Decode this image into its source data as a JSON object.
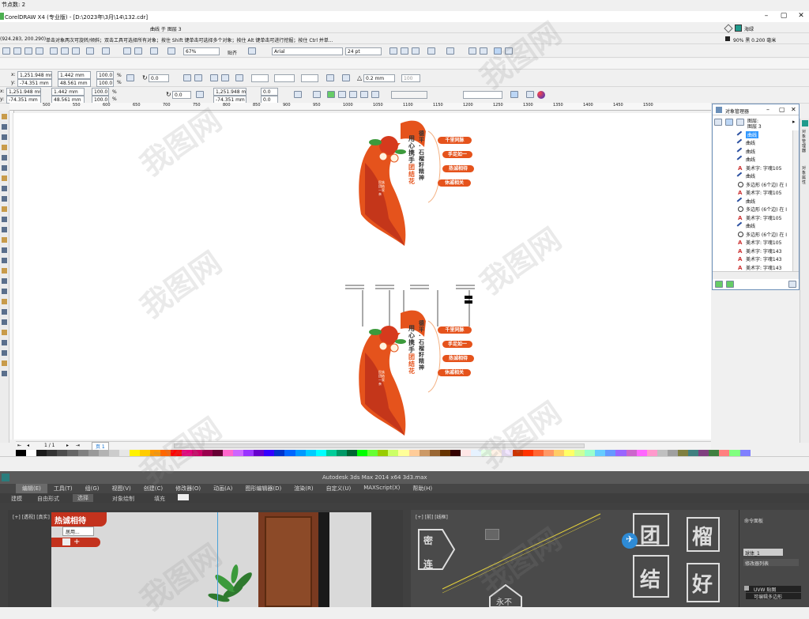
{
  "cdr": {
    "top_left_text": "节点数: 2",
    "window_title": "CorelDRAW X4 (专业版) - [D:\\2023年\\3月\\14\\132.cdr]",
    "window_controls": [
      "–",
      "▢",
      "✕"
    ],
    "selection_status": "曲线 于 图层 3",
    "coords": "(924.283, 200.290)",
    "hint": "单击对象两次可旋转/倾斜；双击工具可选择所有对象；按住 Shift 键单击可选择多个对象；按住 Alt 键单击可进行挖掘；按住 Ctrl 并单...",
    "fill_name": "海绿",
    "outline_info": "90% 黑 0.200 毫米",
    "zoom": "67%",
    "snap_label": "贴齐",
    "font_name": "Arial",
    "font_size": "24 pt",
    "prop1": {
      "x": "1,251.948 mm",
      "y": "-74.351 mm",
      "w": "1.442 mm",
      "h": "48.561 mm",
      "sx": "100.0",
      "sy": "100.0",
      "pct": "%",
      "angle": "0.0",
      "outline_w": "0.2 mm",
      "mirror_pct": "100"
    },
    "prop2": {
      "x": "1,251.948 mm",
      "y": "-74.351 mm",
      "w": "1.442 mm",
      "h": "48.561 mm",
      "sx": "100.0",
      "sy": "100.0",
      "pct": "%",
      "angle": "0.0",
      "px": "1,251.948 mm",
      "py": "-74.351 mm",
      "ox": "0.0",
      "oy": "0.0"
    },
    "ruler_ticks": [
      "500",
      "550",
      "600",
      "650",
      "700",
      "750",
      "800",
      "850",
      "900",
      "950",
      "1000",
      "1050",
      "1100",
      "1150",
      "1200",
      "1250",
      "1300",
      "1350",
      "1400",
      "1450",
      "1500"
    ],
    "page_nav": {
      "count": "1 / 1",
      "page_tab": "页 1"
    }
  },
  "design": {
    "upper": {
      "vertical_left": "用心携手",
      "vertical_left_hl": "团结花",
      "vertical_right": "德平·石榴籽精神",
      "tags": [
        "千里同脉",
        "手足如一",
        "热诚相待",
        "休戚相关"
      ],
      "red_side_text": "民族团结一家亲"
    },
    "lower": {
      "vertical_left": "用心携手",
      "vertical_left_hl": "团结花",
      "vertical_right": "德平·石榴籽精神",
      "tags": [
        "千里同脉",
        "手足如一",
        "热诚相待",
        "休戚相关"
      ],
      "red_side_text": "民族团结一家亲"
    }
  },
  "objmgr": {
    "title": "对象管理器",
    "layer_line1": "图层:",
    "layer_line2": "图层 3",
    "items": [
      {
        "label": "曲线",
        "icon": "curve-icon",
        "selected": true
      },
      {
        "label": "曲线",
        "icon": "curve-icon",
        "selected": false
      },
      {
        "label": "曲线",
        "icon": "curve-icon",
        "selected": false
      },
      {
        "label": "曲线",
        "icon": "curve-icon",
        "selected": false
      },
      {
        "label": "美术字: 字魂105",
        "icon": "artistic-text-icon",
        "selected": false
      },
      {
        "label": "曲线",
        "icon": "curve-icon",
        "selected": false
      },
      {
        "label": "多边形 (6个边) 在 I",
        "icon": "polygon-icon",
        "selected": false
      },
      {
        "label": "美术字: 字魂105",
        "icon": "artistic-text-icon",
        "selected": false
      },
      {
        "label": "曲线",
        "icon": "curve-icon",
        "selected": false
      },
      {
        "label": "多边形 (6个边) 在 I",
        "icon": "polygon-icon",
        "selected": false
      },
      {
        "label": "美术字: 字魂105",
        "icon": "artistic-text-icon",
        "selected": false
      },
      {
        "label": "曲线",
        "icon": "curve-icon",
        "selected": false
      },
      {
        "label": "多边形 (6个边) 在 I",
        "icon": "polygon-icon",
        "selected": false
      },
      {
        "label": "美术字: 字魂105",
        "icon": "artistic-text-icon",
        "selected": false
      },
      {
        "label": "美术字: 字魂143",
        "icon": "artistic-text-icon",
        "selected": false
      },
      {
        "label": "美术字: 字魂143",
        "icon": "artistic-text-icon",
        "selected": false
      },
      {
        "label": "美术字: 字魂143",
        "icon": "artistic-text-icon",
        "selected": false
      }
    ],
    "side_tabs": [
      "对象管理器",
      "对象属性"
    ]
  },
  "max": {
    "title": "Autodesk 3ds Max  2014 x64     3d3.max",
    "menu": [
      "编辑(E)",
      "工具(T)",
      "组(G)",
      "视图(V)",
      "创建(C)",
      "修改器(O)",
      "动画(A)",
      "图形编辑器(D)",
      "渲染(R)",
      "自定义(U)",
      "MAXScript(X)",
      "帮助(H)"
    ],
    "ribbon": [
      "建模",
      "自由形式",
      "选择",
      "对象绘制",
      "填充"
    ],
    "vp1_label": "[+] [透视] [真实]",
    "vp2_label": "[+] [前] [线框]",
    "vp1_sign": "热诚相待",
    "vp1_popup": "居用...",
    "vp2_chars": [
      "团",
      "榴",
      "结",
      "好",
      "密",
      "连",
      "永不"
    ],
    "cmd_title": "命令面板",
    "cmd_field": "球体_1",
    "cmd_modlist": "修改器列表",
    "cmd_items": [
      "UVW 贴图",
      "可编辑多边形"
    ]
  },
  "watermark": "我图网",
  "colors": {
    "accent_orange": "#e5531c",
    "deep_red": "#c4361a",
    "fill_swatch": "#1f9a8c",
    "canvas_bg": "#ffffff",
    "max_bg": "#404040",
    "selected_bg": "#3399ff"
  },
  "palette": [
    "#000000",
    "#ffffff",
    "#1a1a1a",
    "#333333",
    "#4d4d4d",
    "#666666",
    "#808080",
    "#999999",
    "#b3b3b3",
    "#cccccc",
    "#e6e6e6",
    "#fff200",
    "#ffcc00",
    "#ff9900",
    "#ff6600",
    "#ff0000",
    "#e6007e",
    "#cc0066",
    "#99004d",
    "#660033",
    "#ff66cc",
    "#cc66ff",
    "#9933ff",
    "#6600cc",
    "#3300ff",
    "#0033cc",
    "#0066ff",
    "#0099ff",
    "#00ccff",
    "#00ffff",
    "#00cc99",
    "#009966",
    "#006633",
    "#00ff00",
    "#66ff33",
    "#99cc00",
    "#ccff66",
    "#ffff99",
    "#ffcc99",
    "#cc9966",
    "#996633",
    "#663300",
    "#330000",
    "#ffe6e6",
    "#e6f2ff",
    "#e6ffe6",
    "#fff2e6",
    "#f2e6ff",
    "#cc3300",
    "#ff3300",
    "#ff6633",
    "#ff9966",
    "#ffcc66",
    "#ffff66",
    "#ccff99",
    "#99ffcc",
    "#66ccff",
    "#6699ff",
    "#9966ff",
    "#cc66cc",
    "#ff66ff",
    "#ff99cc",
    "#c0c0c0",
    "#a0a0a0",
    "#808040",
    "#408080",
    "#804080",
    "#408040",
    "#ff8080",
    "#80ff80",
    "#8080ff"
  ]
}
